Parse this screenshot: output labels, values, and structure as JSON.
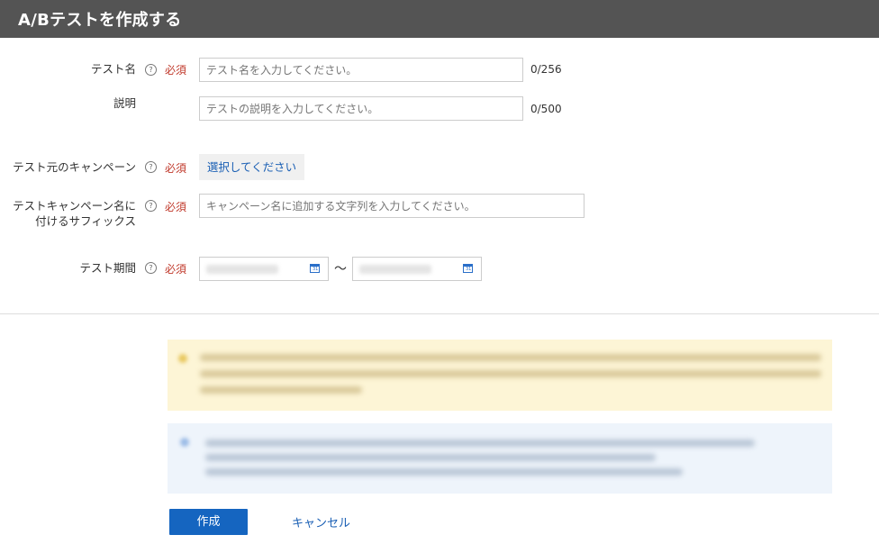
{
  "header": {
    "title": "A/Bテストを作成する"
  },
  "form": {
    "required_label": "必須",
    "help_glyph": "?",
    "test_name": {
      "label": "テスト名",
      "placeholder": "テスト名を入力してください。",
      "counter": "0/256"
    },
    "description": {
      "label": "説明",
      "placeholder": "テストの説明を入力してください。",
      "counter": "0/500"
    },
    "source_campaign": {
      "label": "テスト元のキャンペーン",
      "button_label": "選択してください"
    },
    "suffix": {
      "label_line1": "テストキャンペーン名に",
      "label_line2": "付けるサフィックス",
      "placeholder": "キャンペーン名に追加する文字列を入力してください。"
    },
    "period": {
      "label": "テスト期間",
      "separator": "～",
      "calendar_glyph": "31"
    }
  },
  "actions": {
    "create_label": "作成",
    "cancel_label": "キャンセル"
  },
  "colors": {
    "header_bg": "#545454",
    "primary": "#1565c0",
    "link": "#1a5fb4",
    "required": "#c0392b",
    "warning_bg": "#fdf5d6",
    "info_bg": "#eef4fb"
  },
  "icons": {
    "help": "question-circle-icon",
    "calendar": "calendar-icon"
  }
}
